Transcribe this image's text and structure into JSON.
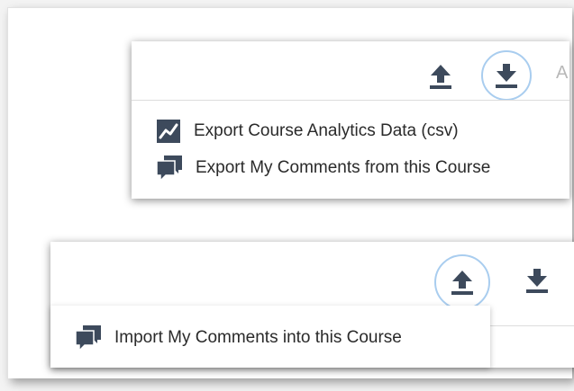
{
  "export_panel": {
    "toolbar": {
      "upload_icon": "upload-icon",
      "download_icon": "download-icon",
      "search_hint": "A"
    },
    "menu": {
      "items": [
        {
          "label": "Export Course Analytics Data (csv)",
          "icon": "analytics-chart-icon"
        },
        {
          "label": "Export My Comments from this Course",
          "icon": "comments-icon"
        }
      ]
    }
  },
  "import_panel": {
    "toolbar": {
      "upload_icon": "upload-icon",
      "download_icon": "download-icon"
    },
    "menu": {
      "items": [
        {
          "label": "Import My Comments into this Course",
          "icon": "comments-icon"
        }
      ]
    }
  },
  "colors": {
    "icon": "#3d4a5c",
    "active_ring": "#a9cdef",
    "text": "#2a2a2a"
  }
}
